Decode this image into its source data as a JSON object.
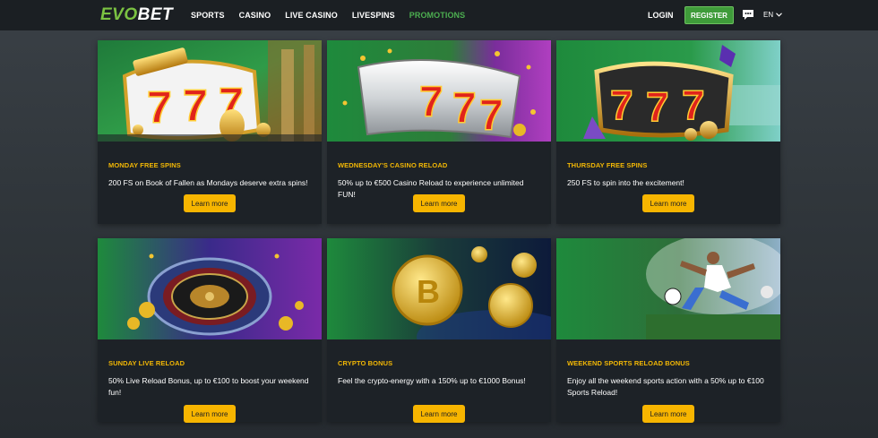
{
  "header": {
    "logo_part1": "EVO",
    "logo_part2": "BET",
    "nav": [
      "SPORTS",
      "CASINO",
      "LIVE CASINO",
      "LIVESPINS",
      "PROMOTIONS"
    ],
    "active_nav": "PROMOTIONS",
    "login_label": "LOGIN",
    "register_label": "REGISTER",
    "language": "EN",
    "chat_icon": "chat-bubble-icon"
  },
  "colors": {
    "accent_green": "#3f9b3a",
    "promo_title": "#f2b705",
    "button_yellow": "#f7b500"
  },
  "promos": [
    {
      "title": "MONDAY FREE SPINS",
      "description": "200 FS on Book of Fallen as Mondays deserve extra spins!",
      "button": "Learn more",
      "image": "slot-777-egyptian"
    },
    {
      "title": "WEDNESDAY'S CASINO RELOAD",
      "description": "50% up to €500 Casino Reload to experience unlimited FUN!",
      "button": "Learn more",
      "image": "slot-777-silver"
    },
    {
      "title": "THURSDAY FREE SPINS",
      "description": "250 FS to spin into the excitement!",
      "button": "Learn more",
      "image": "slot-777-gold"
    },
    {
      "title": "SUNDAY LIVE RELOAD",
      "description": "50% Live Reload Bonus, up to €100 to boost your weekend fun!",
      "button": "Learn more",
      "image": "roulette-wheel"
    },
    {
      "title": "CRYPTO BONUS",
      "description": "Feel the crypto-energy with a 150% up to €1000 Bonus!",
      "button": "Learn more",
      "image": "crypto-coins"
    },
    {
      "title": "WEEKEND SPORTS RELOAD BONUS",
      "description": "Enjoy all the weekend sports action with a 50% up to €100 Sports Reload!",
      "button": "Learn more",
      "image": "football-player"
    }
  ]
}
